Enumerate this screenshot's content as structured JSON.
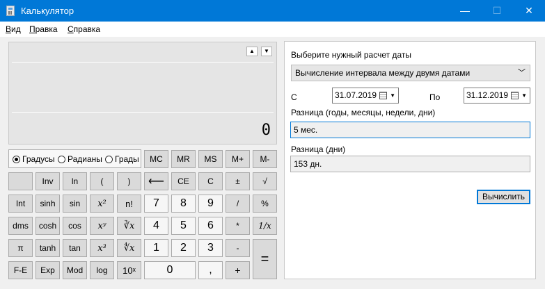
{
  "window": {
    "title": "Калькулятор",
    "min_glyph": "—",
    "max_glyph": "☐",
    "close_glyph": "✕"
  },
  "menu": [
    {
      "hot": "В",
      "rest": "ид"
    },
    {
      "hot": "П",
      "rest": "равка"
    },
    {
      "hot": "С",
      "rest": "правка"
    }
  ],
  "display": {
    "value": "0",
    "scroll_up": "▲",
    "scroll_down": "▼"
  },
  "angle_modes": {
    "degrees": "Градусы",
    "radians": "Радианы",
    "grads": "Грады",
    "selected": "degrees"
  },
  "memory": [
    "MC",
    "MR",
    "MS",
    "M+",
    "M-"
  ],
  "keys": {
    "r1": [
      "",
      "Inv",
      "ln",
      "(",
      ")",
      "⟵",
      "CE",
      "C",
      "±",
      "√"
    ],
    "r2": [
      "Int",
      "sinh",
      "sin",
      "x²",
      "n!",
      "7",
      "8",
      "9",
      "/",
      "%"
    ],
    "r3": [
      "dms",
      "cosh",
      "cos",
      "xʸ",
      "∛x",
      "4",
      "5",
      "6",
      "*",
      "1/x"
    ],
    "r4": [
      "π",
      "tanh",
      "tan",
      "x³",
      "∜x",
      "1",
      "2",
      "3",
      "-"
    ],
    "r5": [
      "F-E",
      "Exp",
      "Mod",
      "log",
      "10ˣ",
      "0",
      ",",
      "+"
    ],
    "equals": "="
  },
  "date_calc": {
    "header": "Выберите нужный расчет даты",
    "mode": "Вычисление интервала между двумя датами",
    "chevron": "﹀",
    "from_label": "С",
    "from_value": "31.07.2019",
    "to_label": "По",
    "to_value": "31.12.2019",
    "diff_label": "Разница (годы, месяцы, недели, дни)",
    "diff_value": "5 мес.",
    "days_label": "Разница (дни)",
    "days_value": "153 дн.",
    "calc_button": "Вычислить"
  }
}
